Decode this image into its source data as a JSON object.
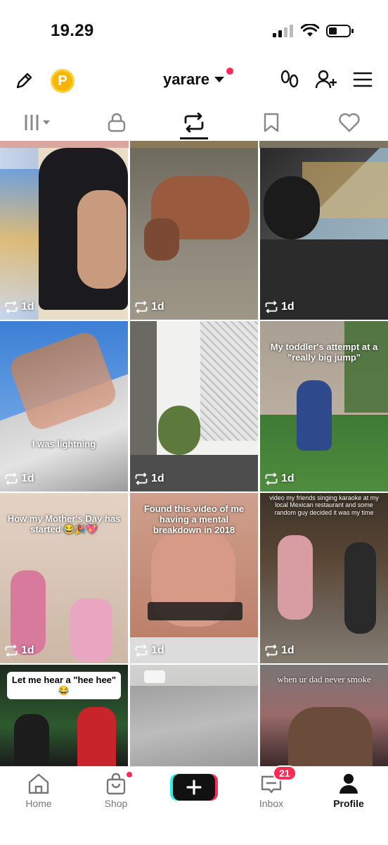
{
  "status_bar": {
    "time": "19.29"
  },
  "header": {
    "username": "yarare",
    "coin_letter": "P"
  },
  "tiles": [
    {
      "meta": "1d",
      "text": ""
    },
    {
      "meta": "1d",
      "text": ""
    },
    {
      "meta": "1d",
      "text": ""
    },
    {
      "meta": "1d",
      "text": "I was lightning"
    },
    {
      "meta": "1d",
      "text": ""
    },
    {
      "meta": "1d",
      "text": "My toddler's attempt at a \"really big jump\""
    },
    {
      "meta": "1d",
      "text": "How my Mother's Day has started 😂🎉💖"
    },
    {
      "meta": "1d",
      "text": "Found this video of me having a mental breakdown in 2018"
    },
    {
      "meta": "1d",
      "text": "video my friends singing karaoke at my local Mexican restaurant and some random guy decided it was my time"
    },
    {
      "meta": "",
      "text": "Let me hear a \"hee hee\" 😂"
    },
    {
      "meta": "",
      "text": ""
    },
    {
      "meta": "",
      "text": "when ur dad never smoke"
    }
  ],
  "bottom_nav": {
    "home": "Home",
    "shop": "Shop",
    "inbox": "Inbox",
    "inbox_badge": "21",
    "profile": "Profile"
  }
}
